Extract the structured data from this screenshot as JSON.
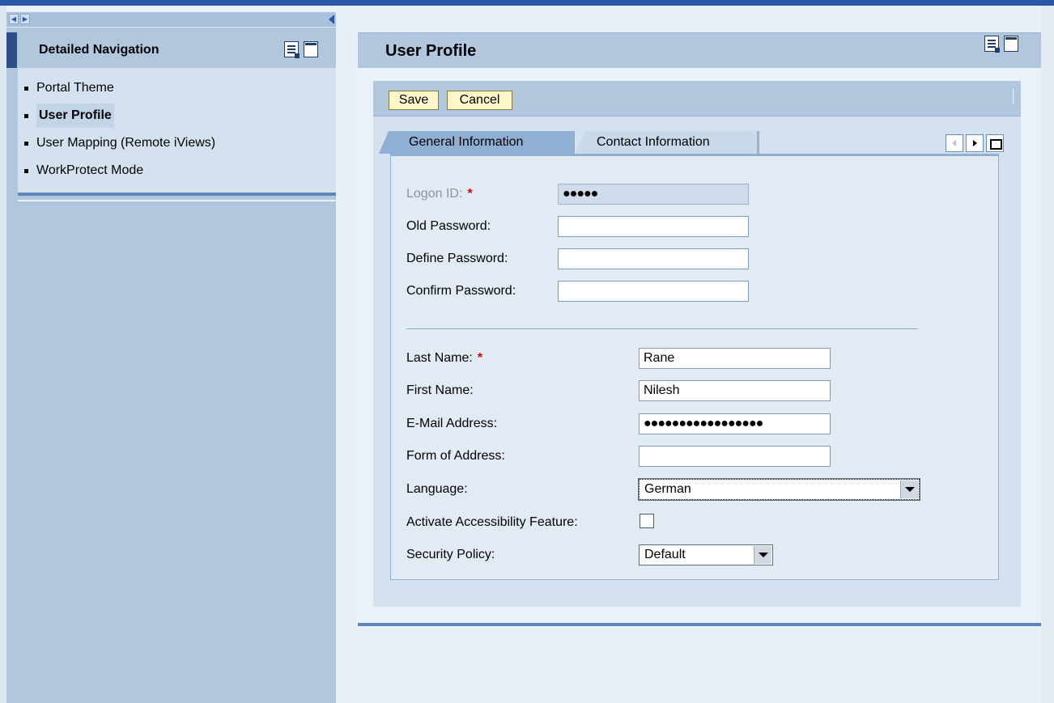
{
  "navigation": {
    "title": "Detailed Navigation",
    "items": [
      {
        "label": "Portal Theme"
      },
      {
        "label": "User Profile",
        "active": true
      },
      {
        "label": "User Mapping (Remote iViews)"
      },
      {
        "label": "WorkProtect Mode"
      }
    ]
  },
  "main": {
    "title": "User Profile",
    "toolbar": {
      "save_label": "Save",
      "cancel_label": "Cancel"
    },
    "tabs": [
      {
        "label": "General Information",
        "active": true
      },
      {
        "label": "Contact Information",
        "active": false
      }
    ],
    "form": {
      "logon_id": {
        "label": "Logon ID:",
        "value": "●●●●●"
      },
      "old_password": {
        "label": "Old Password:",
        "value": ""
      },
      "define_password": {
        "label": "Define Password:",
        "value": ""
      },
      "confirm_password": {
        "label": "Confirm Password:",
        "value": ""
      },
      "last_name": {
        "label": "Last Name:",
        "value": "Rane"
      },
      "first_name": {
        "label": "First Name:",
        "value": "Nilesh"
      },
      "email": {
        "label": "E-Mail Address:",
        "value": "●●●●●●●●●●●●●●●●●"
      },
      "form_of_address": {
        "label": "Form of Address:",
        "value": ""
      },
      "language": {
        "label": "Language:",
        "value": "German"
      },
      "accessibility": {
        "label": "Activate Accessibility Feature:",
        "checked": false
      },
      "security_policy": {
        "label": "Security Policy:",
        "value": "Default"
      }
    },
    "required_marker": "*"
  },
  "colors": {
    "accent": "#2b57a8",
    "panel": "#b0c7dd",
    "required": "#dd0000",
    "button_bg": "#fff7c7"
  }
}
